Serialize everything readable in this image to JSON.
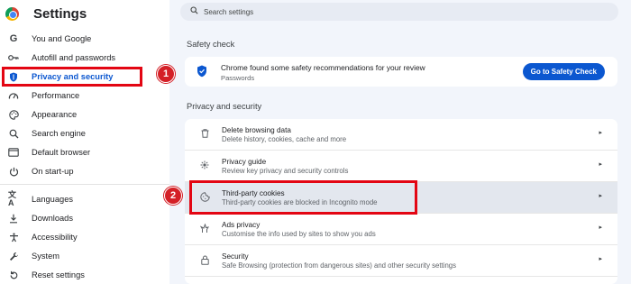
{
  "app": {
    "title": "Settings"
  },
  "search": {
    "placeholder": "Search settings"
  },
  "sidebar": {
    "items": [
      {
        "label": "You and Google",
        "icon": "google-g-icon"
      },
      {
        "label": "Autofill and passwords",
        "icon": "key-icon"
      },
      {
        "label": "Privacy and security",
        "icon": "shield-icon",
        "active": true
      },
      {
        "label": "Performance",
        "icon": "speedometer-icon"
      },
      {
        "label": "Appearance",
        "icon": "palette-icon"
      },
      {
        "label": "Search engine",
        "icon": "search-icon"
      },
      {
        "label": "Default browser",
        "icon": "browser-window-icon"
      },
      {
        "label": "On start-up",
        "icon": "power-icon"
      },
      {
        "label": "Languages",
        "icon": "translate-icon"
      },
      {
        "label": "Downloads",
        "icon": "download-icon"
      },
      {
        "label": "Accessibility",
        "icon": "accessibility-icon"
      },
      {
        "label": "System",
        "icon": "wrench-icon"
      },
      {
        "label": "Reset settings",
        "icon": "reset-icon"
      }
    ]
  },
  "safety_check": {
    "section_title": "Safety check",
    "message": "Chrome found some safety recommendations for your review",
    "sub": "Passwords",
    "button_label": "Go to Safety Check",
    "icon": "shield-check-icon"
  },
  "privacy": {
    "section_title": "Privacy and security",
    "rows": [
      {
        "title": "Delete browsing data",
        "sub": "Delete history, cookies, cache and more",
        "icon": "trash-icon"
      },
      {
        "title": "Privacy guide",
        "sub": "Review key privacy and security controls",
        "icon": "privacy-guide-icon"
      },
      {
        "title": "Third-party cookies",
        "sub": "Third-party cookies are blocked in Incognito mode",
        "icon": "cookie-icon",
        "highlighted": true
      },
      {
        "title": "Ads privacy",
        "sub": "Customise the info used by sites to show you ads",
        "icon": "ads-icon"
      },
      {
        "title": "Security",
        "sub": "Safe Browsing (protection from dangerous sites) and other security settings",
        "icon": "lock-icon"
      }
    ]
  },
  "annotations": {
    "badge_1": "1",
    "badge_2": "2"
  },
  "colors": {
    "accent": "#0b57d0",
    "highlight_border": "#e30613",
    "badge": "#d42027"
  }
}
